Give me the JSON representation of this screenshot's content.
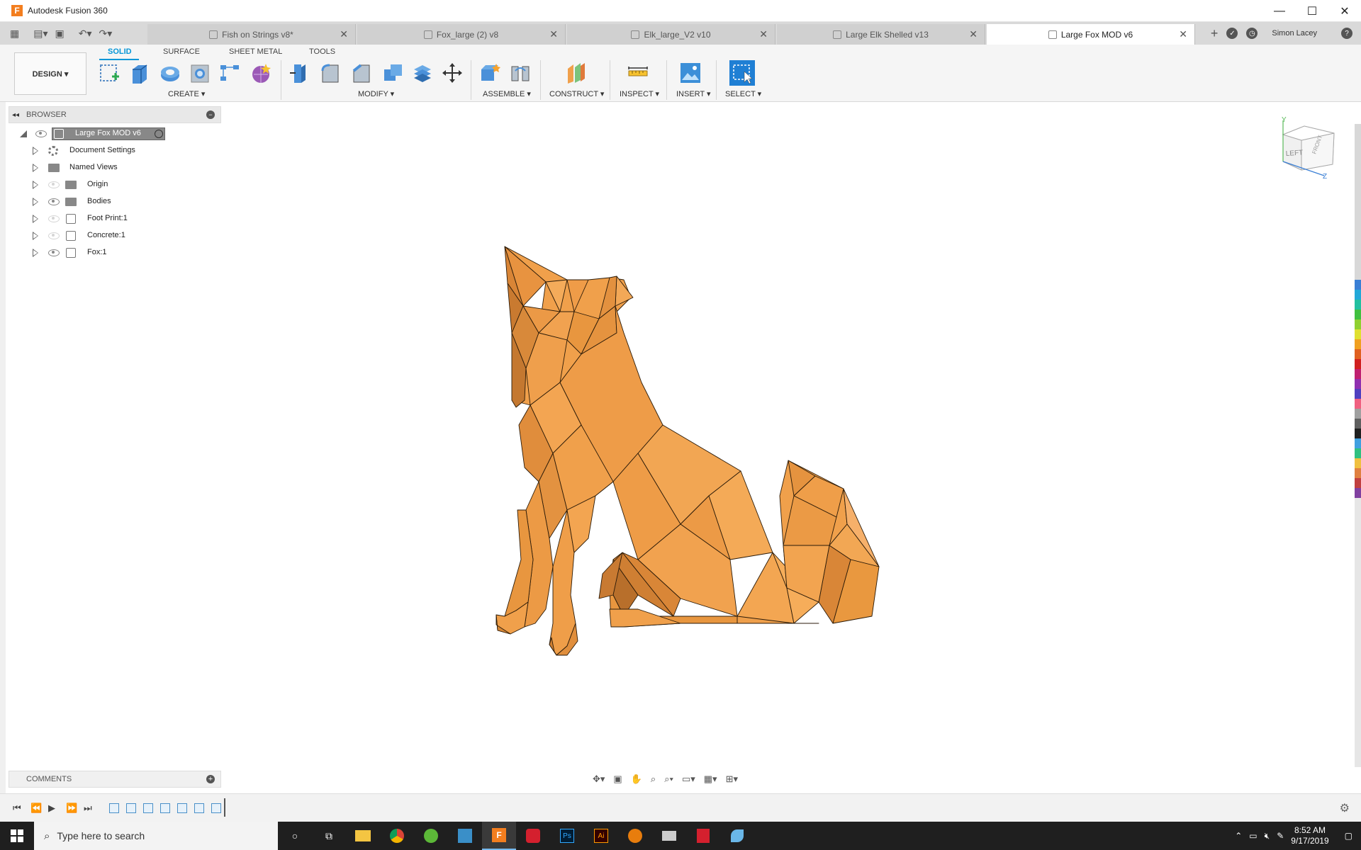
{
  "window": {
    "title": "Autodesk Fusion 360",
    "app_icon": "F"
  },
  "window_controls": {
    "minimize": "—",
    "maximize": "☐",
    "close": "✕"
  },
  "tabs": [
    {
      "label": "Fish on Strings v8*"
    },
    {
      "label": "Fox_large (2) v8"
    },
    {
      "label": "Elk_large_V2 v10"
    },
    {
      "label": "Large Elk Shelled v13"
    },
    {
      "label": "Large Fox MOD v6"
    }
  ],
  "user": {
    "name": "Simon Lacey"
  },
  "toolbar": {
    "workspace": "DESIGN ▾",
    "tabs": [
      "SOLID",
      "SURFACE",
      "SHEET METAL",
      "TOOLS"
    ],
    "groups": [
      "CREATE ▾",
      "MODIFY ▾",
      "ASSEMBLE ▾",
      "CONSTRUCT ▾",
      "INSPECT ▾",
      "INSERT ▾",
      "SELECT ▾"
    ]
  },
  "browser": {
    "title": "BROWSER",
    "root": "Large Fox MOD v6",
    "items": [
      {
        "label": "Document Settings",
        "icon": "gear-icon",
        "eye": "none"
      },
      {
        "label": "Named Views",
        "icon": "folder-icon",
        "eye": "none"
      },
      {
        "label": "Origin",
        "icon": "folder-icon",
        "eye": "hidden"
      },
      {
        "label": "Bodies",
        "icon": "folder-icon",
        "eye": "visible"
      },
      {
        "label": "Foot Print:1",
        "icon": "component-icon",
        "eye": "hidden"
      },
      {
        "label": "Concrete:1",
        "icon": "component-icon",
        "eye": "hidden"
      },
      {
        "label": "Fox:1",
        "icon": "component-icon",
        "eye": "visible"
      }
    ]
  },
  "comments": {
    "title": "COMMENTS"
  },
  "viewcube": {
    "face_left": "LEFT",
    "face_front": "FRONT",
    "axis_y": "Y",
    "axis_z": "Z"
  },
  "taskbar": {
    "search_placeholder": "Type here to search",
    "time": "8:52 AM",
    "date": "9/17/2019"
  },
  "colors": {
    "model": "#f0a04b",
    "accent": "#0696d7"
  }
}
